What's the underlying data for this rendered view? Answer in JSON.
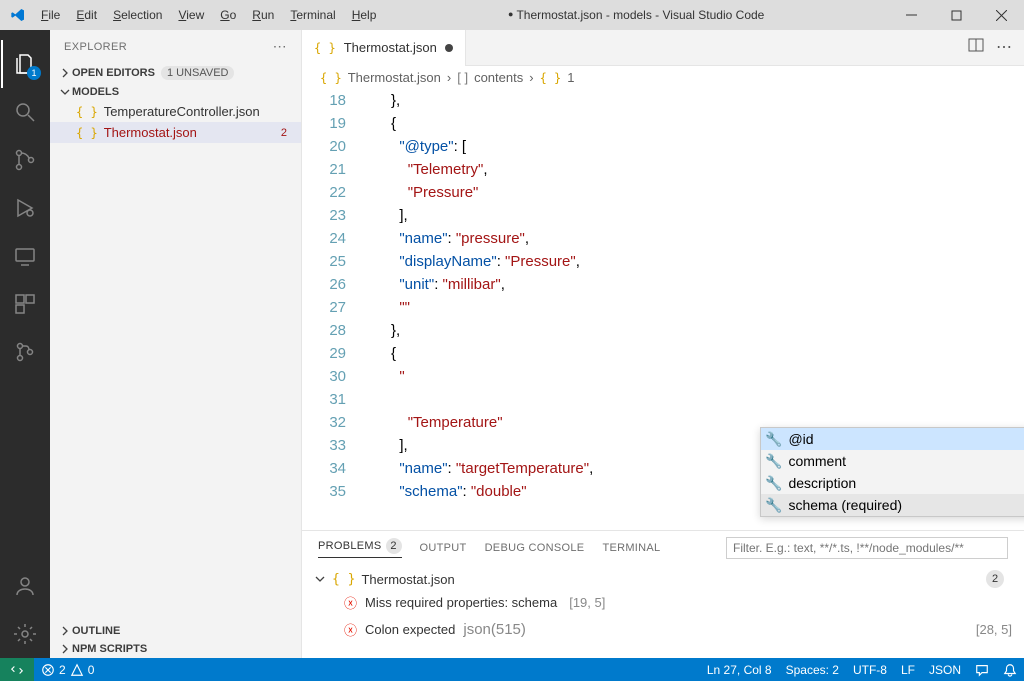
{
  "menus": [
    "File",
    "Edit",
    "Selection",
    "View",
    "Go",
    "Run",
    "Terminal",
    "Help"
  ],
  "title": "Thermostat.json - models - Visual Studio Code",
  "activity": {
    "explorer_badge": "1"
  },
  "sidebar": {
    "title": "EXPLORER",
    "open_editors": "OPEN EDITORS",
    "unsaved": "1 UNSAVED",
    "root": "MODELS",
    "files": [
      {
        "name": "TemperatureController.json"
      },
      {
        "name": "Thermostat.json",
        "errors": "2"
      }
    ],
    "outline": "OUTLINE",
    "npm": "NPM SCRIPTS"
  },
  "tabs": {
    "active": "Thermostat.json"
  },
  "breadcrumb": {
    "file": "Thermostat.json",
    "p1": "contents",
    "p2": "1",
    "braces": "{ }",
    "brackets": "[  ]"
  },
  "code": {
    "lines": [
      {
        "n": 18,
        "ind": 3,
        "frags": [
          {
            "c": "pun",
            "t": "},"
          }
        ]
      },
      {
        "n": 19,
        "ind": 3,
        "frags": [
          {
            "c": "pun",
            "t": "{"
          }
        ]
      },
      {
        "n": 20,
        "ind": 4,
        "frags": [
          {
            "c": "key",
            "t": "\"@type\""
          },
          {
            "c": "pun",
            "t": ": ["
          }
        ]
      },
      {
        "n": 21,
        "ind": 5,
        "frags": [
          {
            "c": "red",
            "t": "\"Telemetry\""
          },
          {
            "c": "pun",
            "t": ","
          }
        ]
      },
      {
        "n": 22,
        "ind": 5,
        "frags": [
          {
            "c": "red",
            "t": "\"Pressure\""
          }
        ]
      },
      {
        "n": 23,
        "ind": 4,
        "frags": [
          {
            "c": "pun",
            "t": "],"
          }
        ]
      },
      {
        "n": 24,
        "ind": 4,
        "frags": [
          {
            "c": "key",
            "t": "\"name\""
          },
          {
            "c": "pun",
            "t": ": "
          },
          {
            "c": "red",
            "t": "\"pressure\""
          },
          {
            "c": "pun",
            "t": ","
          }
        ]
      },
      {
        "n": 25,
        "ind": 4,
        "frags": [
          {
            "c": "key",
            "t": "\"displayName\""
          },
          {
            "c": "pun",
            "t": ": "
          },
          {
            "c": "red",
            "t": "\"Pressure\""
          },
          {
            "c": "pun",
            "t": ","
          }
        ]
      },
      {
        "n": 26,
        "ind": 4,
        "frags": [
          {
            "c": "key",
            "t": "\"unit\""
          },
          {
            "c": "pun",
            "t": ": "
          },
          {
            "c": "red",
            "t": "\"millibar\""
          },
          {
            "c": "pun",
            "t": ","
          }
        ]
      },
      {
        "n": 27,
        "ind": 4,
        "frags": [
          {
            "c": "red",
            "t": "\"\""
          }
        ]
      },
      {
        "n": 28,
        "ind": 3,
        "frags": [
          {
            "c": "pun",
            "t": "},"
          }
        ]
      },
      {
        "n": 29,
        "ind": 3,
        "frags": [
          {
            "c": "pun",
            "t": "{"
          }
        ]
      },
      {
        "n": 30,
        "ind": 4,
        "frags": [
          {
            "c": "red",
            "t": "\""
          }
        ]
      },
      {
        "n": 31,
        "ind": 5,
        "frags": []
      },
      {
        "n": 32,
        "ind": 5,
        "frags": [
          {
            "c": "red",
            "t": "\"Temperature\""
          }
        ]
      },
      {
        "n": 33,
        "ind": 4,
        "frags": [
          {
            "c": "pun",
            "t": "],"
          }
        ]
      },
      {
        "n": 34,
        "ind": 4,
        "frags": [
          {
            "c": "key",
            "t": "\"name\""
          },
          {
            "c": "pun",
            "t": ": "
          },
          {
            "c": "red",
            "t": "\"targetTemperature\""
          },
          {
            "c": "pun",
            "t": ","
          }
        ]
      },
      {
        "n": 35,
        "ind": 4,
        "frags": [
          {
            "c": "key",
            "t": "\"schema\""
          },
          {
            "c": "pun",
            "t": ": "
          },
          {
            "c": "red",
            "t": "\"double\""
          }
        ]
      }
    ]
  },
  "suggest": {
    "items": [
      "@id",
      "comment",
      "description",
      "schema (required)"
    ]
  },
  "panel": {
    "tabs": {
      "problems": "PROBLEMS",
      "problems_count": "2",
      "output": "OUTPUT",
      "debug": "DEBUG CONSOLE",
      "terminal": "TERMINAL"
    },
    "filter_placeholder": "Filter. E.g.: text, **/*.ts, !**/node_modules/**",
    "file": "Thermostat.json",
    "file_count": "2",
    "problems": [
      {
        "msg": "Miss required properties: schema",
        "loc": "[19, 5]"
      },
      {
        "msg": "Colon expected",
        "code": "json(515)",
        "loc": "[28, 5]"
      }
    ]
  },
  "status": {
    "errors": "2",
    "warnings": "0",
    "lncol": "Ln 27, Col 8",
    "spaces": "Spaces: 2",
    "enc": "UTF-8",
    "eol": "LF",
    "lang": "JSON"
  }
}
